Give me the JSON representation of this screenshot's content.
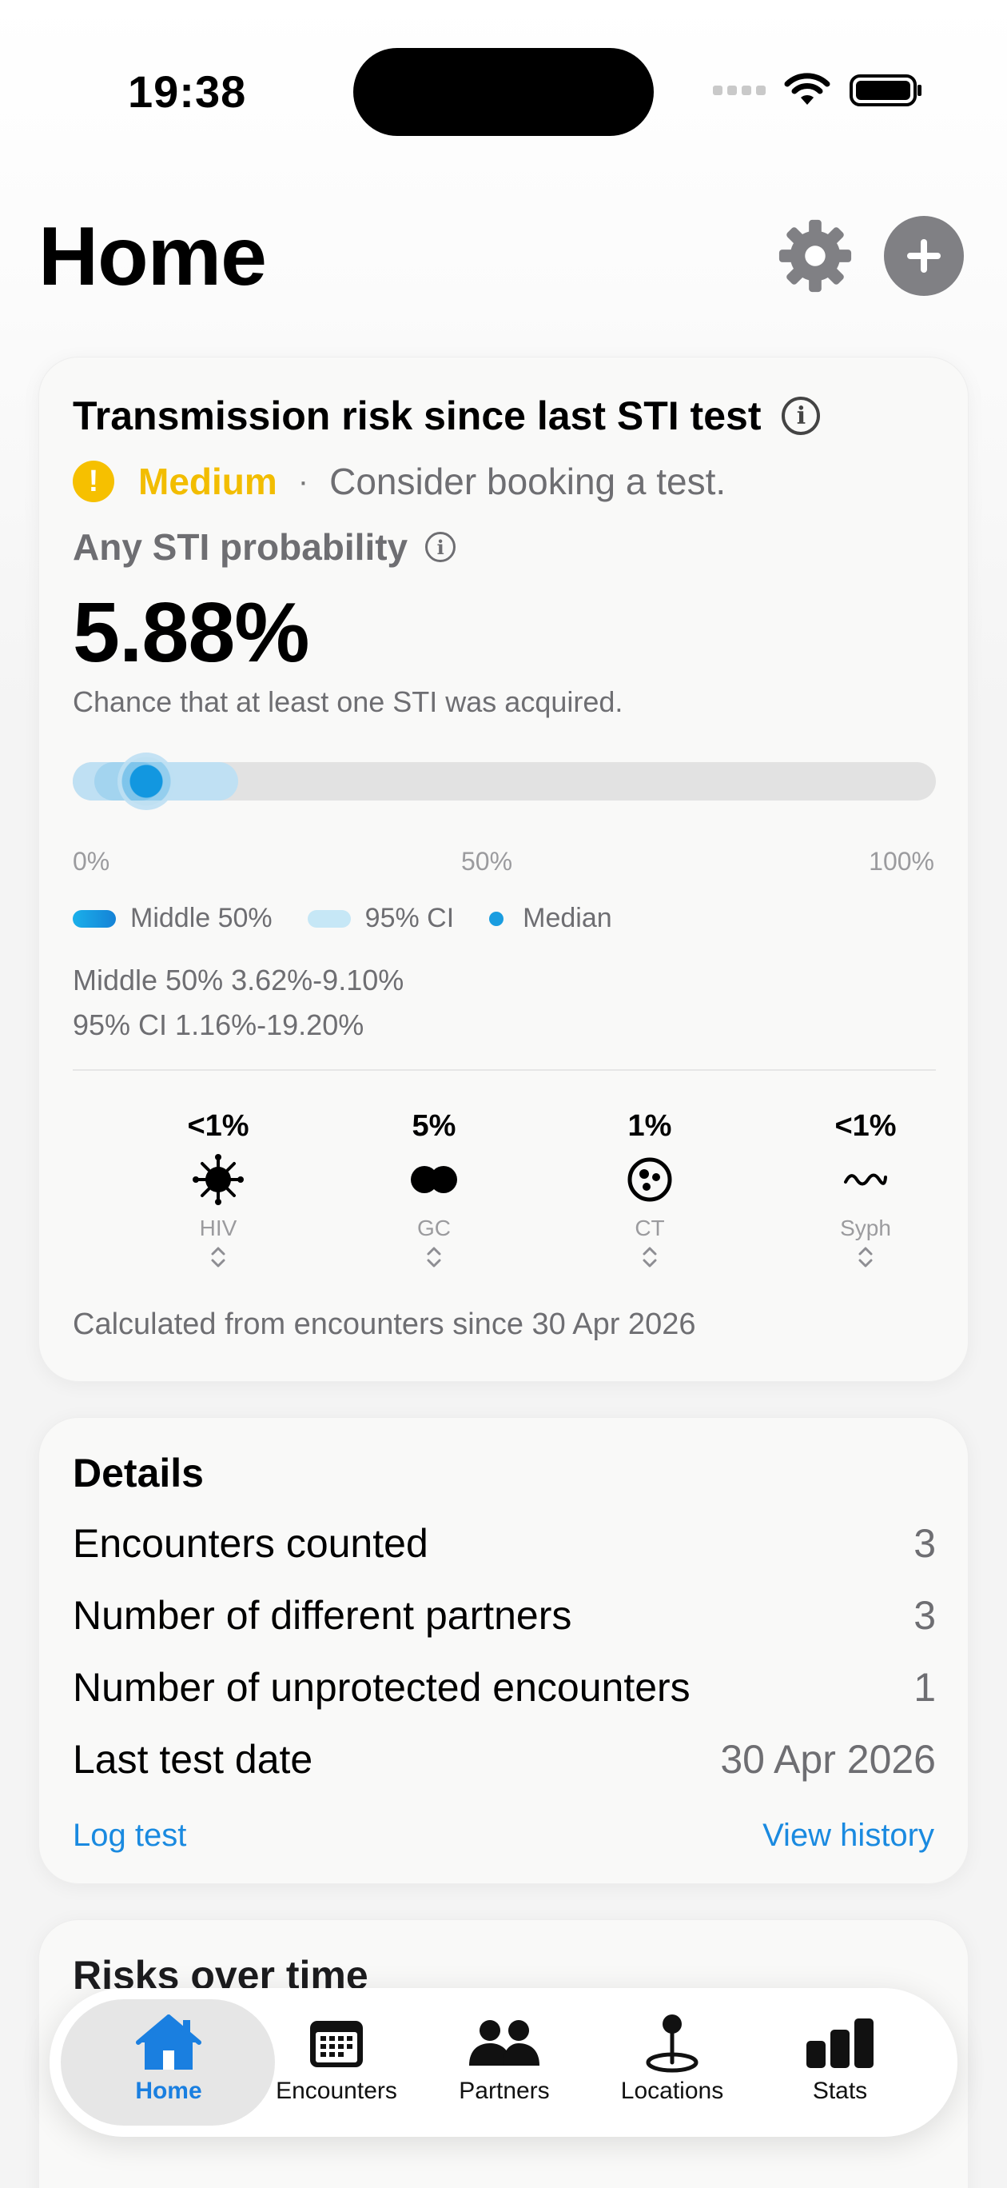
{
  "status_bar": {
    "time": "19:38"
  },
  "header": {
    "title": "Home"
  },
  "risk_card": {
    "title": "Transmission risk since last STI test",
    "level": "Medium",
    "separator": "·",
    "advice": "Consider booking a test.",
    "probability_label": "Any STI probability",
    "probability_value": "5.88%",
    "probability_desc": "Chance that at least one STI was acquired.",
    "bar": {
      "median": 5.88,
      "middle50": [
        3.62,
        9.1
      ],
      "ci95": [
        1.16,
        19.2
      ]
    },
    "ticks": [
      "0%",
      "50%",
      "100%"
    ],
    "legend": {
      "middle": "Middle 50%",
      "ci": "95% CI",
      "median": "Median"
    },
    "middle50_text": "Middle 50% 3.62%-9.10%",
    "ci95_text": "95% CI 1.16%-19.20%",
    "stis": [
      {
        "value": "<1%",
        "name": "HIV",
        "icon": "virus-icon"
      },
      {
        "value": "5%",
        "name": "GC",
        "icon": "diplococcus-icon"
      },
      {
        "value": "1%",
        "name": "CT",
        "icon": "bacteria-cluster-icon"
      },
      {
        "value": "<1%",
        "name": "Syph",
        "icon": "spiral-wave-icon"
      }
    ],
    "calc_note": "Calculated from encounters since 30 Apr 2026"
  },
  "details": {
    "title": "Details",
    "rows": [
      {
        "label": "Encounters counted",
        "value": "3"
      },
      {
        "label": "Number of different partners",
        "value": "3"
      },
      {
        "label": "Number of unprotected encounters",
        "value": "1"
      },
      {
        "label": "Last test date",
        "value": "30 Apr 2026"
      }
    ],
    "log_test": "Log test",
    "view_history": "View history"
  },
  "risks_over_time": {
    "title": "Risks over time"
  },
  "tabs": [
    {
      "label": "Home",
      "icon": "house-icon",
      "active": true
    },
    {
      "label": "Encounters",
      "icon": "calendar-icon"
    },
    {
      "label": "Partners",
      "icon": "people-icon"
    },
    {
      "label": "Locations",
      "icon": "map-pin-icon"
    },
    {
      "label": "Stats",
      "icon": "bar-chart-icon"
    }
  ],
  "colors": {
    "accent": "#1a8ae0",
    "warning": "#f6c000",
    "ci_band": "#bfe0f3",
    "median": "#1297e0"
  }
}
